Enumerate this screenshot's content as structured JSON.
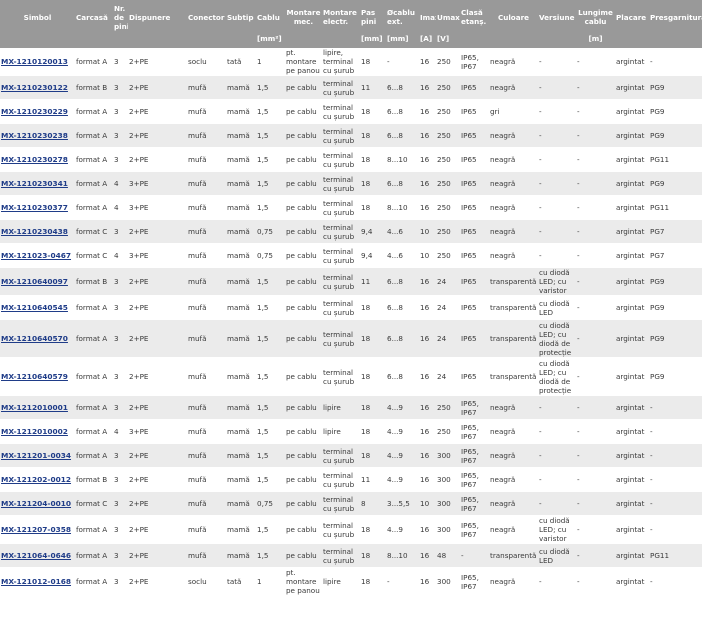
{
  "headers": {
    "simbol": "Simbol",
    "carcasa": "Carcasă",
    "nr_pini": "Nr. de pini",
    "dispunere": "Dispunere",
    "conector": "Conector",
    "subtip": "Subtip",
    "cablu": "Cablu",
    "montare_mec": "Montare mec.",
    "montare_electr": "Montare electr.",
    "pas_pini": "Pas pini",
    "diam_cablu": "Øcablu ext.",
    "imax": "Imax",
    "umax": "Umax",
    "clasa": "Clasă etanș.",
    "culoare": "Culoare",
    "versiune": "Versiune",
    "lungime": "Lungime cablu",
    "placare": "Placare",
    "presgarnitura": "Presgarnitura"
  },
  "units": {
    "cablu": "[mm²]",
    "pas_pini": "[mm]",
    "diam_cablu": "[mm]",
    "imax": "[A]",
    "umax": "[V]",
    "lungime": "[m]"
  },
  "rows": [
    {
      "simbol": "MX-1210120013",
      "carcasa": "format A",
      "nr": "3",
      "disp": "2+PE",
      "con": "soclu",
      "subtip": "tată",
      "cablu": "1",
      "mec": "pt. montare pe panou",
      "electr": "lipire, terminal cu șurub",
      "pas": "18",
      "diam": "-",
      "imax": "16",
      "umax": "250",
      "clasa": "IP65, IP67",
      "culoare": "neagră",
      "vers": "-",
      "lung": "-",
      "plac": "argintat",
      "pres": "-"
    },
    {
      "simbol": "MX-1210230122",
      "carcasa": "format B",
      "nr": "3",
      "disp": "2+PE",
      "con": "mufă",
      "subtip": "mamă",
      "cablu": "1,5",
      "mec": "pe cablu",
      "electr": "terminal cu șurub",
      "pas": "11",
      "diam": "6...8",
      "imax": "16",
      "umax": "250",
      "clasa": "IP65",
      "culoare": "neagră",
      "vers": "-",
      "lung": "-",
      "plac": "argintat",
      "pres": "PG9"
    },
    {
      "simbol": "MX-1210230229",
      "carcasa": "format A",
      "nr": "3",
      "disp": "2+PE",
      "con": "mufă",
      "subtip": "mamă",
      "cablu": "1,5",
      "mec": "pe cablu",
      "electr": "terminal cu șurub",
      "pas": "18",
      "diam": "6...8",
      "imax": "16",
      "umax": "250",
      "clasa": "IP65",
      "culoare": "gri",
      "vers": "-",
      "lung": "-",
      "plac": "argintat",
      "pres": "PG9"
    },
    {
      "simbol": "MX-1210230238",
      "carcasa": "format A",
      "nr": "3",
      "disp": "2+PE",
      "con": "mufă",
      "subtip": "mamă",
      "cablu": "1,5",
      "mec": "pe cablu",
      "electr": "terminal cu șurub",
      "pas": "18",
      "diam": "6...8",
      "imax": "16",
      "umax": "250",
      "clasa": "IP65",
      "culoare": "neagră",
      "vers": "-",
      "lung": "-",
      "plac": "argintat",
      "pres": "PG9"
    },
    {
      "simbol": "MX-1210230278",
      "carcasa": "format A",
      "nr": "3",
      "disp": "2+PE",
      "con": "mufă",
      "subtip": "mamă",
      "cablu": "1,5",
      "mec": "pe cablu",
      "electr": "terminal cu șurub",
      "pas": "18",
      "diam": "8...10",
      "imax": "16",
      "umax": "250",
      "clasa": "IP65",
      "culoare": "neagră",
      "vers": "-",
      "lung": "-",
      "plac": "argintat",
      "pres": "PG11"
    },
    {
      "simbol": "MX-1210230341",
      "carcasa": "format A",
      "nr": "4",
      "disp": "3+PE",
      "con": "mufă",
      "subtip": "mamă",
      "cablu": "1,5",
      "mec": "pe cablu",
      "electr": "terminal cu șurub",
      "pas": "18",
      "diam": "6...8",
      "imax": "16",
      "umax": "250",
      "clasa": "IP65",
      "culoare": "neagră",
      "vers": "-",
      "lung": "-",
      "plac": "argintat",
      "pres": "PG9"
    },
    {
      "simbol": "MX-1210230377",
      "carcasa": "format A",
      "nr": "4",
      "disp": "3+PE",
      "con": "mufă",
      "subtip": "mamă",
      "cablu": "1,5",
      "mec": "pe cablu",
      "electr": "terminal cu șurub",
      "pas": "18",
      "diam": "8...10",
      "imax": "16",
      "umax": "250",
      "clasa": "IP65",
      "culoare": "neagră",
      "vers": "-",
      "lung": "-",
      "plac": "argintat",
      "pres": "PG11"
    },
    {
      "simbol": "MX-1210230438",
      "carcasa": "format C",
      "nr": "3",
      "disp": "2+PE",
      "con": "mufă",
      "subtip": "mamă",
      "cablu": "0,75",
      "mec": "pe cablu",
      "electr": "terminal cu șurub",
      "pas": "9,4",
      "diam": "4...6",
      "imax": "10",
      "umax": "250",
      "clasa": "IP65",
      "culoare": "neagră",
      "vers": "-",
      "lung": "-",
      "plac": "argintat",
      "pres": "PG7"
    },
    {
      "simbol": "MX-121023-0467",
      "carcasa": "format C",
      "nr": "4",
      "disp": "3+PE",
      "con": "mufă",
      "subtip": "mamă",
      "cablu": "0,75",
      "mec": "pe cablu",
      "electr": "terminal cu șurub",
      "pas": "9,4",
      "diam": "4...6",
      "imax": "10",
      "umax": "250",
      "clasa": "IP65",
      "culoare": "neagră",
      "vers": "-",
      "lung": "-",
      "plac": "argintat",
      "pres": "PG7"
    },
    {
      "simbol": "MX-1210640097",
      "carcasa": "format B",
      "nr": "3",
      "disp": "2+PE",
      "con": "mufă",
      "subtip": "mamă",
      "cablu": "1,5",
      "mec": "pe cablu",
      "electr": "terminal cu șurub",
      "pas": "11",
      "diam": "6...8",
      "imax": "16",
      "umax": "24",
      "clasa": "IP65",
      "culoare": "transparentă",
      "vers": "cu diodă LED; cu varistor",
      "lung": "-",
      "plac": "argintat",
      "pres": "PG9"
    },
    {
      "simbol": "MX-1210640545",
      "carcasa": "format A",
      "nr": "3",
      "disp": "2+PE",
      "con": "mufă",
      "subtip": "mamă",
      "cablu": "1,5",
      "mec": "pe cablu",
      "electr": "terminal cu șurub",
      "pas": "18",
      "diam": "6...8",
      "imax": "16",
      "umax": "24",
      "clasa": "IP65",
      "culoare": "transparentă",
      "vers": "cu diodă LED",
      "lung": "-",
      "plac": "argintat",
      "pres": "PG9"
    },
    {
      "simbol": "MX-1210640570",
      "carcasa": "format A",
      "nr": "3",
      "disp": "2+PE",
      "con": "mufă",
      "subtip": "mamă",
      "cablu": "1,5",
      "mec": "pe cablu",
      "electr": "terminal cu șurub",
      "pas": "18",
      "diam": "6...8",
      "imax": "16",
      "umax": "24",
      "clasa": "IP65",
      "culoare": "transparentă",
      "vers": "cu diodă LED; cu diodă de protecție",
      "lung": "-",
      "plac": "argintat",
      "pres": "PG9"
    },
    {
      "simbol": "MX-1210640579",
      "carcasa": "format A",
      "nr": "3",
      "disp": "2+PE",
      "con": "mufă",
      "subtip": "mamă",
      "cablu": "1,5",
      "mec": "pe cablu",
      "electr": "terminal cu șurub",
      "pas": "18",
      "diam": "6...8",
      "imax": "16",
      "umax": "24",
      "clasa": "IP65",
      "culoare": "transparentă",
      "vers": "cu diodă LED; cu diodă de protecție",
      "lung": "-",
      "plac": "argintat",
      "pres": "PG9"
    },
    {
      "simbol": "MX-1212010001",
      "carcasa": "format A",
      "nr": "3",
      "disp": "2+PE",
      "con": "mufă",
      "subtip": "mamă",
      "cablu": "1,5",
      "mec": "pe cablu",
      "electr": "lipire",
      "pas": "18",
      "diam": "4...9",
      "imax": "16",
      "umax": "250",
      "clasa": "IP65, IP67",
      "culoare": "neagră",
      "vers": "-",
      "lung": "-",
      "plac": "argintat",
      "pres": "-"
    },
    {
      "simbol": "MX-1212010002",
      "carcasa": "format A",
      "nr": "4",
      "disp": "3+PE",
      "con": "mufă",
      "subtip": "mamă",
      "cablu": "1,5",
      "mec": "pe cablu",
      "electr": "lipire",
      "pas": "18",
      "diam": "4...9",
      "imax": "16",
      "umax": "250",
      "clasa": "IP65, IP67",
      "culoare": "neagră",
      "vers": "-",
      "lung": "-",
      "plac": "argintat",
      "pres": "-"
    },
    {
      "simbol": "MX-121201-0034",
      "carcasa": "format A",
      "nr": "3",
      "disp": "2+PE",
      "con": "mufă",
      "subtip": "mamă",
      "cablu": "1,5",
      "mec": "pe cablu",
      "electr": "terminal cu șurub",
      "pas": "18",
      "diam": "4...9",
      "imax": "16",
      "umax": "300",
      "clasa": "IP65, IP67",
      "culoare": "neagră",
      "vers": "-",
      "lung": "-",
      "plac": "argintat",
      "pres": "-"
    },
    {
      "simbol": "MX-121202-0012",
      "carcasa": "format B",
      "nr": "3",
      "disp": "2+PE",
      "con": "mufă",
      "subtip": "mamă",
      "cablu": "1,5",
      "mec": "pe cablu",
      "electr": "terminal cu șurub",
      "pas": "11",
      "diam": "4...9",
      "imax": "16",
      "umax": "300",
      "clasa": "IP65, IP67",
      "culoare": "neagră",
      "vers": "-",
      "lung": "-",
      "plac": "argintat",
      "pres": "-"
    },
    {
      "simbol": "MX-121204-0010",
      "carcasa": "format C",
      "nr": "3",
      "disp": "2+PE",
      "con": "mufă",
      "subtip": "mamă",
      "cablu": "0,75",
      "mec": "pe cablu",
      "electr": "terminal cu șurub",
      "pas": "8",
      "diam": "3...5,5",
      "imax": "10",
      "umax": "300",
      "clasa": "IP65, IP67",
      "culoare": "neagră",
      "vers": "-",
      "lung": "-",
      "plac": "argintat",
      "pres": "-"
    },
    {
      "simbol": "MX-121207-0358",
      "carcasa": "format A",
      "nr": "3",
      "disp": "2+PE",
      "con": "mufă",
      "subtip": "mamă",
      "cablu": "1,5",
      "mec": "pe cablu",
      "electr": "terminal cu șurub",
      "pas": "18",
      "diam": "4...9",
      "imax": "16",
      "umax": "300",
      "clasa": "IP65, IP67",
      "culoare": "neagră",
      "vers": "cu diodă LED; cu varistor",
      "lung": "-",
      "plac": "argintat",
      "pres": "-"
    },
    {
      "simbol": "MX-121064-0646",
      "carcasa": "format A",
      "nr": "3",
      "disp": "2+PE",
      "con": "mufă",
      "subtip": "mamă",
      "cablu": "1,5",
      "mec": "pe cablu",
      "electr": "terminal cu șurub",
      "pas": "18",
      "diam": "8...10",
      "imax": "16",
      "umax": "48",
      "clasa": "-",
      "culoare": "transparentă",
      "vers": "cu diodă LED",
      "lung": "-",
      "plac": "argintat",
      "pres": "PG11"
    },
    {
      "simbol": "MX-121012-0168",
      "carcasa": "format A",
      "nr": "3",
      "disp": "2+PE",
      "con": "soclu",
      "subtip": "tată",
      "cablu": "1",
      "mec": "pt. montare pe panou",
      "electr": "lipire",
      "pas": "18",
      "diam": "-",
      "imax": "16",
      "umax": "300",
      "clasa": "IP65, IP67",
      "culoare": "neagră",
      "vers": "-",
      "lung": "-",
      "plac": "argintat",
      "pres": "-"
    }
  ],
  "row_heights": [],
  "colors": {
    "header_bg": "#999999",
    "row_alt": "#ebebeb",
    "link": "#1f3c88"
  }
}
